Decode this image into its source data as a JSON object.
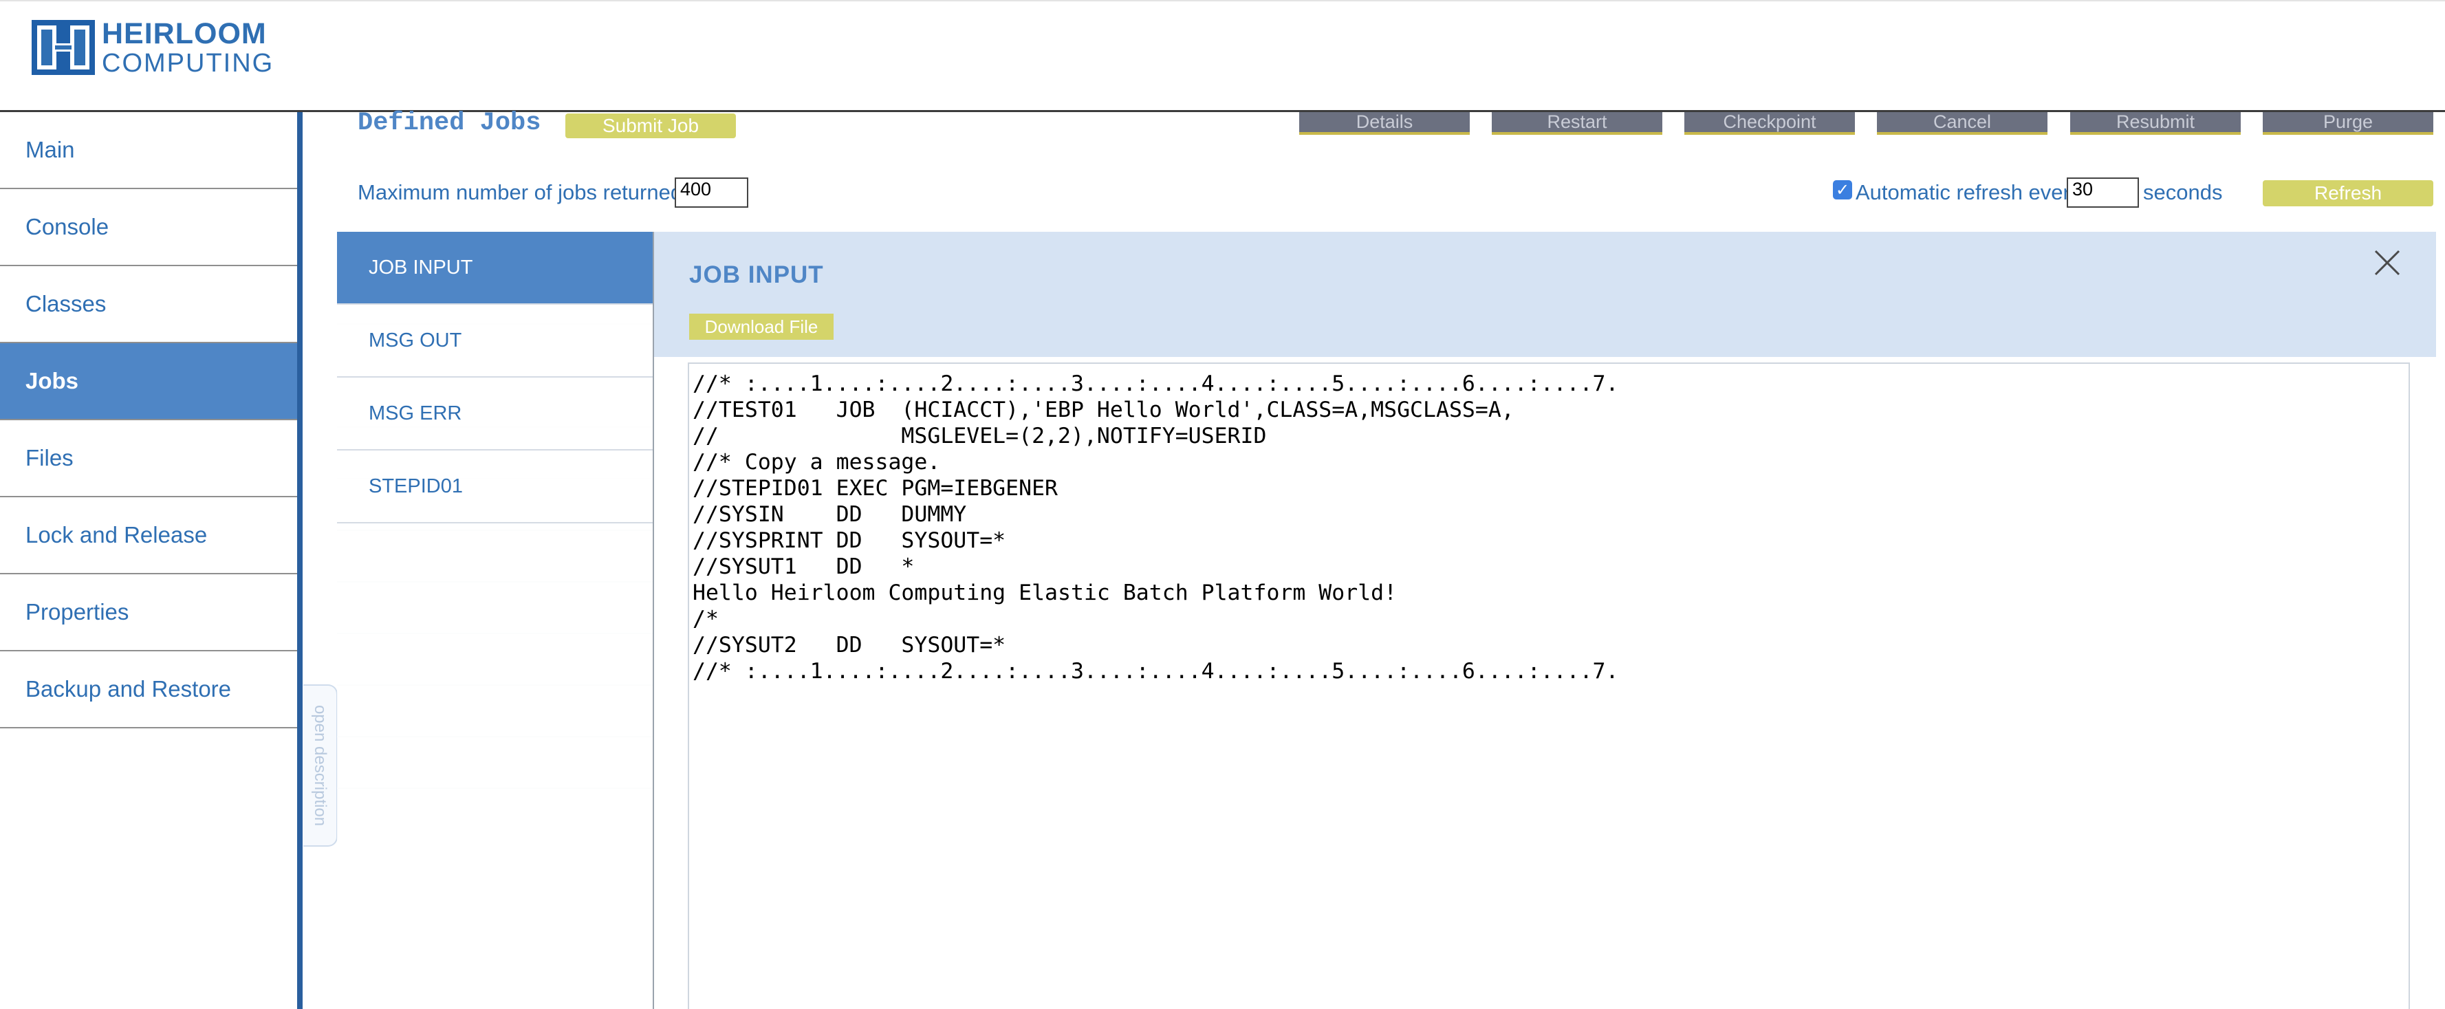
{
  "header": {
    "logo_line1": "HEIRLOOM",
    "logo_line2": "COMPUTING",
    "logo_icon": "heirloom-logo-icon"
  },
  "sidebar": {
    "items": [
      {
        "label": "Main",
        "active": false
      },
      {
        "label": "Console",
        "active": false
      },
      {
        "label": "Classes",
        "active": false
      },
      {
        "label": "Jobs",
        "active": true
      },
      {
        "label": "Files",
        "active": false
      },
      {
        "label": "Lock and Release",
        "active": false
      },
      {
        "label": "Properties",
        "active": false
      },
      {
        "label": "Backup and Restore",
        "active": false
      }
    ],
    "open_description": "open description"
  },
  "main": {
    "title": "Defined Jobs",
    "submit_button": "Submit Job",
    "action_buttons": [
      "Details",
      "Restart",
      "Checkpoint",
      "Cancel",
      "Resubmit",
      "Purge"
    ],
    "max_jobs_label": "Maximum number of jobs returned",
    "max_jobs_value": "400",
    "auto_refresh_checked": true,
    "auto_refresh_label": "Automatic refresh every",
    "auto_refresh_value": "30",
    "seconds_label": "seconds",
    "refresh_button": "Refresh"
  },
  "modal": {
    "tabs": [
      {
        "label": "JOB INPUT",
        "active": true
      },
      {
        "label": "MSG OUT",
        "active": false
      },
      {
        "label": "MSG ERR",
        "active": false
      },
      {
        "label": "STEPID01",
        "active": false
      }
    ],
    "title": "JOB INPUT",
    "download_button": "Download File",
    "close_icon": "close-icon",
    "code_lines": [
      "//* :....1....:....2....:....3....:....4....:....5....:....6....:....7.",
      "//TEST01   JOB  (HCIACCT),'EBP Hello World',CLASS=A,MSGCLASS=A,",
      "//              MSGLEVEL=(2,2),NOTIFY=USERID",
      "//* Copy a message.",
      "//STEPID01 EXEC PGM=IEBGENER",
      "//SYSIN    DD   DUMMY",
      "//SYSPRINT DD   SYSOUT=*",
      "//SYSUT1   DD   *",
      "Hello Heirloom Computing Elastic Batch Platform World!",
      "/*",
      "//SYSUT2   DD   SYSOUT=*",
      "//* :....1....:....2....:....3....:....4....:....5....:....6....:....7."
    ]
  },
  "colors": {
    "brand_blue": "#2f6fb3",
    "active_blue": "#4f86c6",
    "sidebar_border": "#2a5f9e",
    "button_yellow": "#d4d46a",
    "button_gray": "#6b7080",
    "modal_header": "#d6e3f3"
  }
}
